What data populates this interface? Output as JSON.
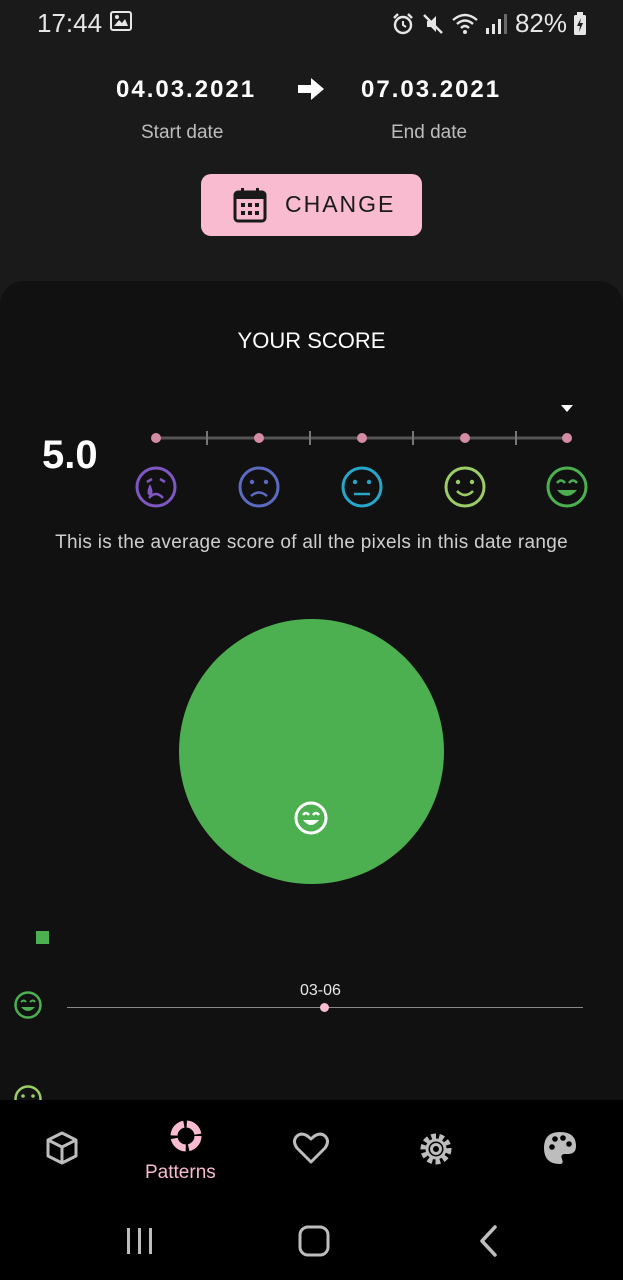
{
  "status_bar": {
    "time": "17:44",
    "battery": "82%",
    "icons": [
      "image-icon",
      "alarm-icon",
      "mute-icon",
      "wifi-icon",
      "signal-icon",
      "battery-charging-icon"
    ]
  },
  "date_range": {
    "start_date": "04.03.2021",
    "end_date": "07.03.2021",
    "start_label": "Start date",
    "end_label": "End date"
  },
  "change_button": {
    "label": "CHANGE",
    "icon": "calendar-icon"
  },
  "score": {
    "title": "YOUR SCORE",
    "value": "5.0",
    "level": 5,
    "max_level": 5,
    "description": "This is the average score of all the pixels in this date range",
    "moods": [
      {
        "name": "very-bad",
        "color": "#7e57c2"
      },
      {
        "name": "bad",
        "color": "#5c6bc0"
      },
      {
        "name": "neutral",
        "color": "#26a6c9"
      },
      {
        "name": "good",
        "color": "#9ccc65"
      },
      {
        "name": "very-good",
        "color": "#4caf50"
      }
    ]
  },
  "pie": {
    "color": "#4caf50",
    "share_very_good": 1.0
  },
  "timeline": {
    "point_label": "03-06"
  },
  "bottom_nav": {
    "items": [
      {
        "icon": "cube-icon",
        "label": ""
      },
      {
        "icon": "patterns-icon",
        "label": "Patterns",
        "active": true
      },
      {
        "icon": "heart-icon",
        "label": ""
      },
      {
        "icon": "settings-icon",
        "label": ""
      },
      {
        "icon": "palette-icon",
        "label": ""
      }
    ],
    "active_color": "#f8bbd0"
  },
  "colors": {
    "accent": "#f8bbd0",
    "background": "#1a1a1a",
    "card": "#111111"
  }
}
